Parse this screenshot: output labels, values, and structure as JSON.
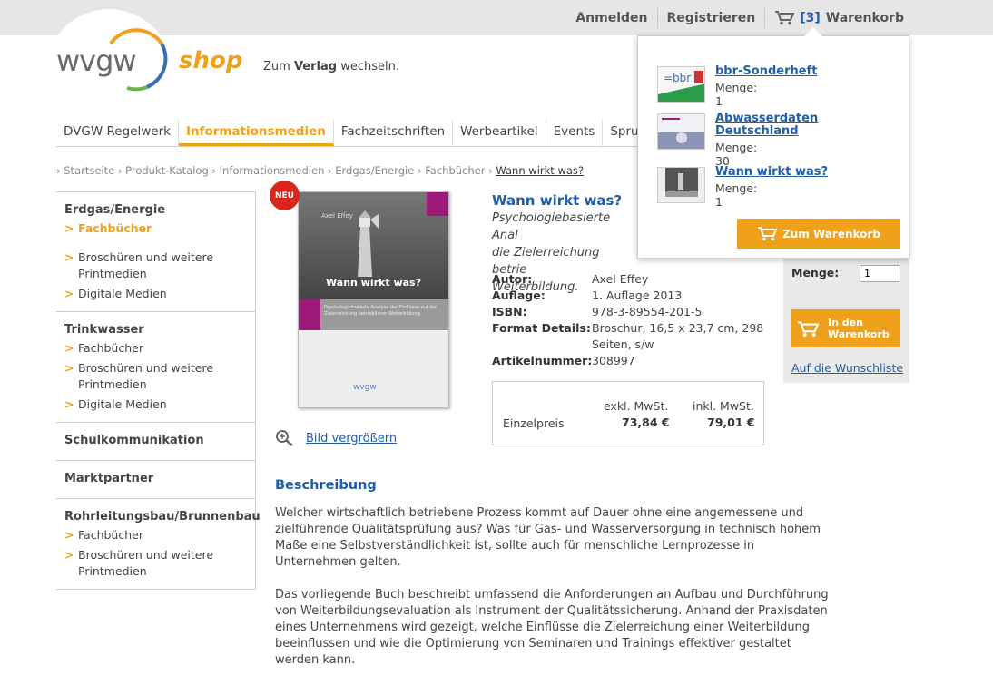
{
  "topbar": {
    "login": "Anmelden",
    "register": "Registrieren",
    "cart_count": "[3]",
    "cart_label": "Warenkorb"
  },
  "logo": {
    "brand": "wvgw",
    "shop": "shop"
  },
  "verlag_link": {
    "prefix": "Zum",
    "bold": "Verlag",
    "suffix": "wechseln."
  },
  "nav": {
    "items": [
      "DVGW-Regelwerk",
      "Informationsmedien",
      "Fachzeitschriften",
      "Werbeartikel",
      "Events",
      "Sprudle"
    ],
    "active_index": 1
  },
  "breadcrumb": {
    "items": [
      "› Startseite",
      "› Produkt-Katalog",
      "› Informationsmedien",
      "› Erdgas/Energie",
      "› Fachbücher",
      "› "
    ],
    "current": "Wann wirkt was?"
  },
  "sidebar": {
    "sections": [
      {
        "title": "Erdgas/Energie",
        "items": [
          "Fachbücher",
          "Broschüren und weitere Printmedien",
          "Digitale Medien"
        ]
      },
      {
        "title": "Trinkwasser",
        "items": [
          "Fachbücher",
          "Broschüren und weitere Printmedien",
          "Digitale Medien"
        ]
      },
      {
        "title": "Schulkommunikation"
      },
      {
        "title": "Marktpartner"
      },
      {
        "title": "Rohrleitungsbau/Brunnenbau",
        "items": [
          "Fachbücher",
          "Broschüren und weitere Printmedien"
        ]
      }
    ]
  },
  "product": {
    "badge": "NEU",
    "cover": {
      "author": "Axel Effey",
      "title": "Wann wirkt was?",
      "subtitle": "Psychologiebasierte Analyse der Einflüsse auf die Zielerreichung betrieblicher Weiterbildung",
      "logo": "wvgw"
    },
    "zoom_label": "Bild vergrößern",
    "title": "Wann wirkt was?",
    "subtitle": "Psychologiebasierte Anal... die Zielerreichung betrie... Weiterbildung.",
    "subtitle_lines": [
      "Psychologiebasierte Anal",
      "die Zielerreichung betrie",
      "Weiterbildung."
    ],
    "specs": [
      {
        "label": "Autor:",
        "value": "Axel Effey"
      },
      {
        "label": "Auflage:",
        "value": "1. Auflage 2013"
      },
      {
        "label": "ISBN:",
        "value": "978-3-89554-201-5"
      },
      {
        "label": "Format Details:",
        "value": "Broschur, 16,5 x 23,7 cm, 298 Seiten, s/w"
      },
      {
        "label": "Artikelnummer:",
        "value": "308997"
      }
    ],
    "price": {
      "excl_header": "exkl. MwSt.",
      "incl_header": "inkl. MwSt.",
      "label": "Einzelpreis",
      "excl": "73,84 €",
      "incl": "79,01 €"
    }
  },
  "buybox": {
    "qty_label": "Menge:",
    "qty_value": "1",
    "add_button": "In den Warenkorb",
    "wishlist": "Auf die Wunschliste"
  },
  "description": {
    "heading": "Beschreibung",
    "paragraphs": [
      "Welcher wirtschaftlich betriebene Prozess kommt auf Dauer ohne eine angemessene und zielführende Qualitätsprüfung aus? Was für Gas- und Wasserversorgung in technisch hohem Maße eine Selbstverständlichkeit ist, sollte auch für menschliche Lernprozesse in Unternehmen gelten.",
      "Das vorliegende Buch beschreibt umfassend die Anforderungen an Aufbau und Durchführung von Weiterbildungsevaluation als Instrument der Qualitätssicherung. Anhand der Praxisdaten eines Unternehmens wird gezeigt, welche Einflüsse die Zielerreichung einer Weiterbildung beeinflussen und wie die Optimierung von Seminaren und Trainings effektiver gestaltet werden kann."
    ]
  },
  "cart_dropdown": {
    "items": [
      {
        "name": "bbr-Sonderheft",
        "qty": "Menge: 1"
      },
      {
        "name": "Abwasserdaten Deutschland",
        "qty": "Menge: 30"
      },
      {
        "name": "Wann wirkt was?",
        "qty": "Menge: 1"
      }
    ],
    "button": "Zum Warenkorb"
  },
  "colors": {
    "accent": "#f0a11c",
    "link": "#1f5fa8",
    "badge": "#d9261c",
    "topbar": "#e6e6e6"
  }
}
